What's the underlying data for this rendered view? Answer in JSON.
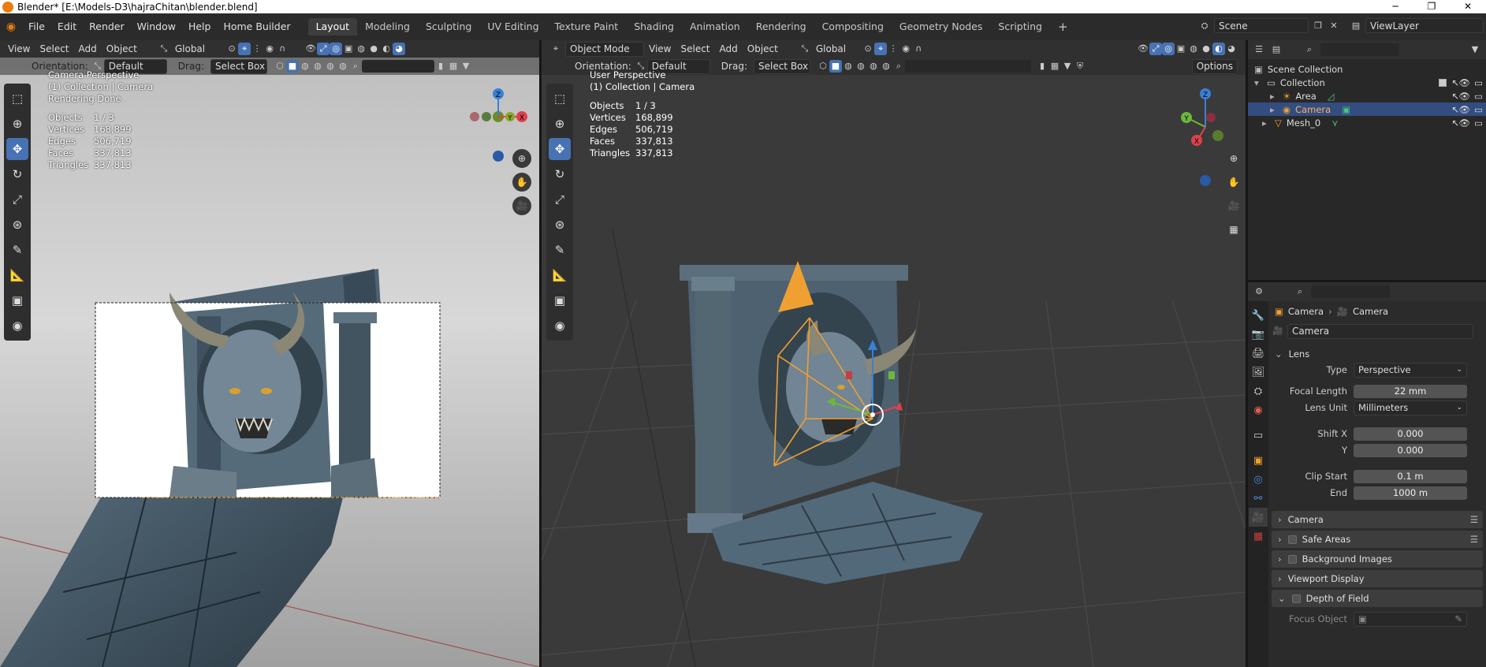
{
  "window": {
    "title": "Blender* [E:\\Models-D3\\hajraChitan\\blender.blend]",
    "controls": [
      "─",
      "❐",
      "✕"
    ]
  },
  "topmenu": [
    "File",
    "Edit",
    "Render",
    "Window",
    "Help",
    "Home Builder"
  ],
  "workspaces": [
    "Layout",
    "Modeling",
    "Sculpting",
    "UV Editing",
    "Texture Paint",
    "Shading",
    "Animation",
    "Rendering",
    "Compositing",
    "Geometry Nodes",
    "Scripting"
  ],
  "scene": {
    "name": "Scene",
    "view_layer": "ViewLayer"
  },
  "left_viewport": {
    "menus": [
      "View",
      "Select",
      "Add",
      "Object"
    ],
    "transform": "Global",
    "orientation_label": "Orientation:",
    "orientation": "Default",
    "drag_label": "Drag:",
    "drag": "Select Box",
    "info": [
      "Camera Perspective",
      "(1) Collection | Camera",
      "Rendering Done"
    ],
    "stats": [
      [
        "Objects",
        "1 / 3"
      ],
      [
        "Vertices",
        "168,899"
      ],
      [
        "Edges",
        "506,719"
      ],
      [
        "Faces",
        "337,813"
      ],
      [
        "Triangles",
        "337,813"
      ]
    ]
  },
  "right_viewport": {
    "mode": "Object Mode",
    "menus": [
      "View",
      "Select",
      "Add",
      "Object"
    ],
    "transform": "Global",
    "orientation_label": "Orientation:",
    "orientation": "Default",
    "drag_label": "Drag:",
    "drag": "Select Box",
    "options": "Options",
    "info": [
      "User Perspective",
      "(1) Collection | Camera"
    ],
    "stats": [
      [
        "Objects",
        "1 / 3"
      ],
      [
        "Vertices",
        "168,899"
      ],
      [
        "Edges",
        "506,719"
      ],
      [
        "Faces",
        "337,813"
      ],
      [
        "Triangles",
        "337,813"
      ]
    ]
  },
  "gizmo": {
    "x": "X",
    "y": "Y",
    "z": "Z"
  },
  "outliner": {
    "root": "Scene Collection",
    "items": [
      {
        "name": "Collection",
        "icon": "collection-icon"
      },
      {
        "name": "Area",
        "icon": "light-icon"
      },
      {
        "name": "Camera",
        "icon": "camera-icon",
        "selected": true
      },
      {
        "name": "Mesh_0",
        "icon": "mesh-icon"
      }
    ]
  },
  "properties": {
    "breadcrumb": [
      "Camera",
      "Camera"
    ],
    "datablock": "Camera",
    "lens_panel": "Lens",
    "type_label": "Type",
    "type": "Perspective",
    "focal_label": "Focal Length",
    "focal": "22 mm",
    "lens_unit_label": "Lens Unit",
    "lens_unit": "Millimeters",
    "shiftx_label": "Shift X",
    "shiftx": "0.000",
    "shifty_label": "Y",
    "shifty": "0.000",
    "clip_start_label": "Clip Start",
    "clip_start": "0.1 m",
    "clip_end_label": "End",
    "clip_end": "1000 m",
    "panels": [
      "Camera",
      "Safe Areas",
      "Background Images",
      "Viewport Display",
      "Depth of Field"
    ],
    "focus_label": "Focus Object"
  },
  "colors": {
    "accent": "#4772b3",
    "selected_row": "#334d80",
    "camera_orange": "#f0a030"
  }
}
